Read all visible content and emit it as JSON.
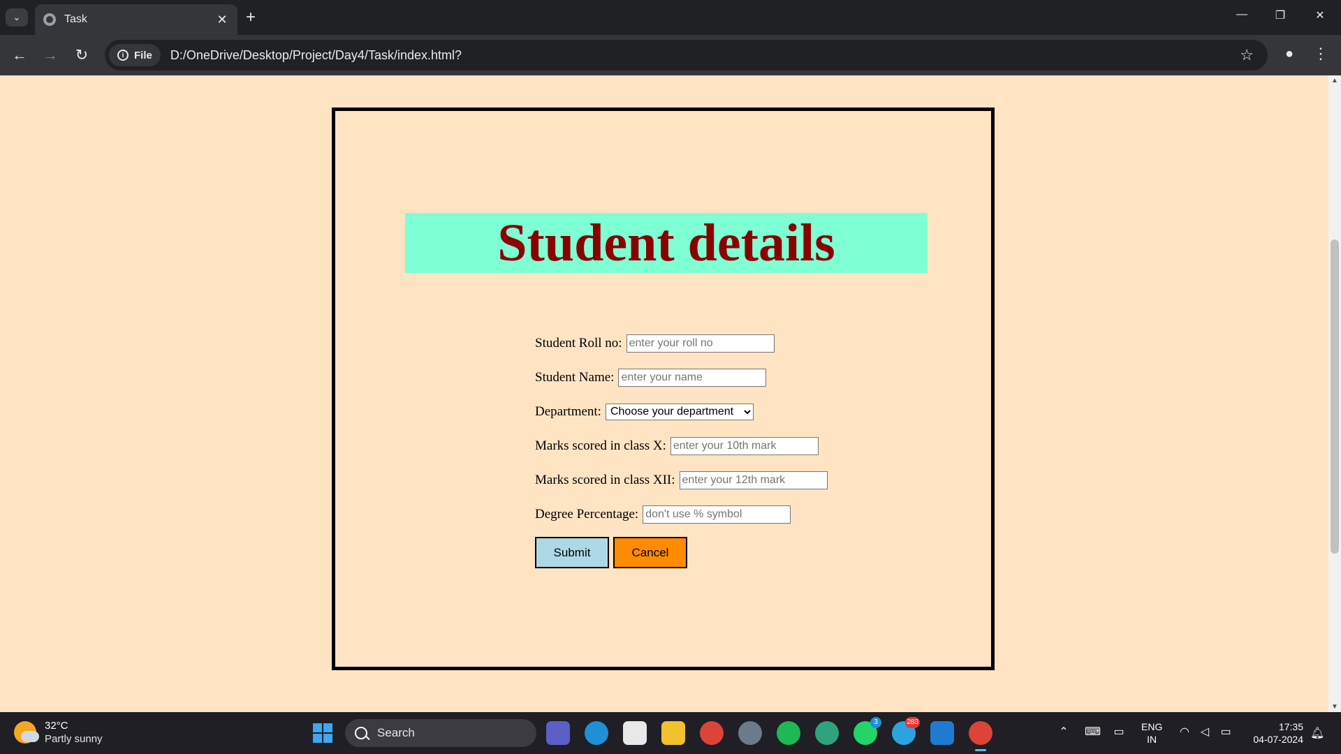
{
  "browser": {
    "tab_title": "Task",
    "tab_close": "✕",
    "new_tab": "+",
    "chip_label": "File",
    "url": "D:/OneDrive/Desktop/Project/Day4/Task/index.html?"
  },
  "page": {
    "heading": "Student details",
    "form": {
      "roll_label": "Student Roll no:",
      "roll_placeholder": "enter your roll no",
      "name_label": "Student Name:",
      "name_placeholder": "enter your name",
      "dept_label": "Department:",
      "dept_selected": "Choose your department",
      "x_label": "Marks scored in class X:",
      "x_placeholder": "enter your 10th mark",
      "xii_label": "Marks scored in class XII:",
      "xii_placeholder": "enter your 12th mark",
      "degree_label": "Degree Percentage:",
      "degree_placeholder": "don't use % symbol",
      "submit_label": "Submit",
      "cancel_label": "Cancel"
    },
    "colors": {
      "background": "#ffe4c4",
      "heading_bg": "#7fffd4",
      "heading_text": "#8b0000",
      "submit_bg": "#add8e6",
      "cancel_bg": "#ff8c00"
    }
  },
  "taskbar": {
    "weather_temp": "32°C",
    "weather_condition": "Partly sunny",
    "search_label": "Search",
    "teams_badge": "",
    "whatsapp_badge": "3",
    "telegram_badge": "283",
    "lang_top": "ENG",
    "lang_bottom": "IN",
    "time": "17:35",
    "date": "04-07-2024"
  }
}
